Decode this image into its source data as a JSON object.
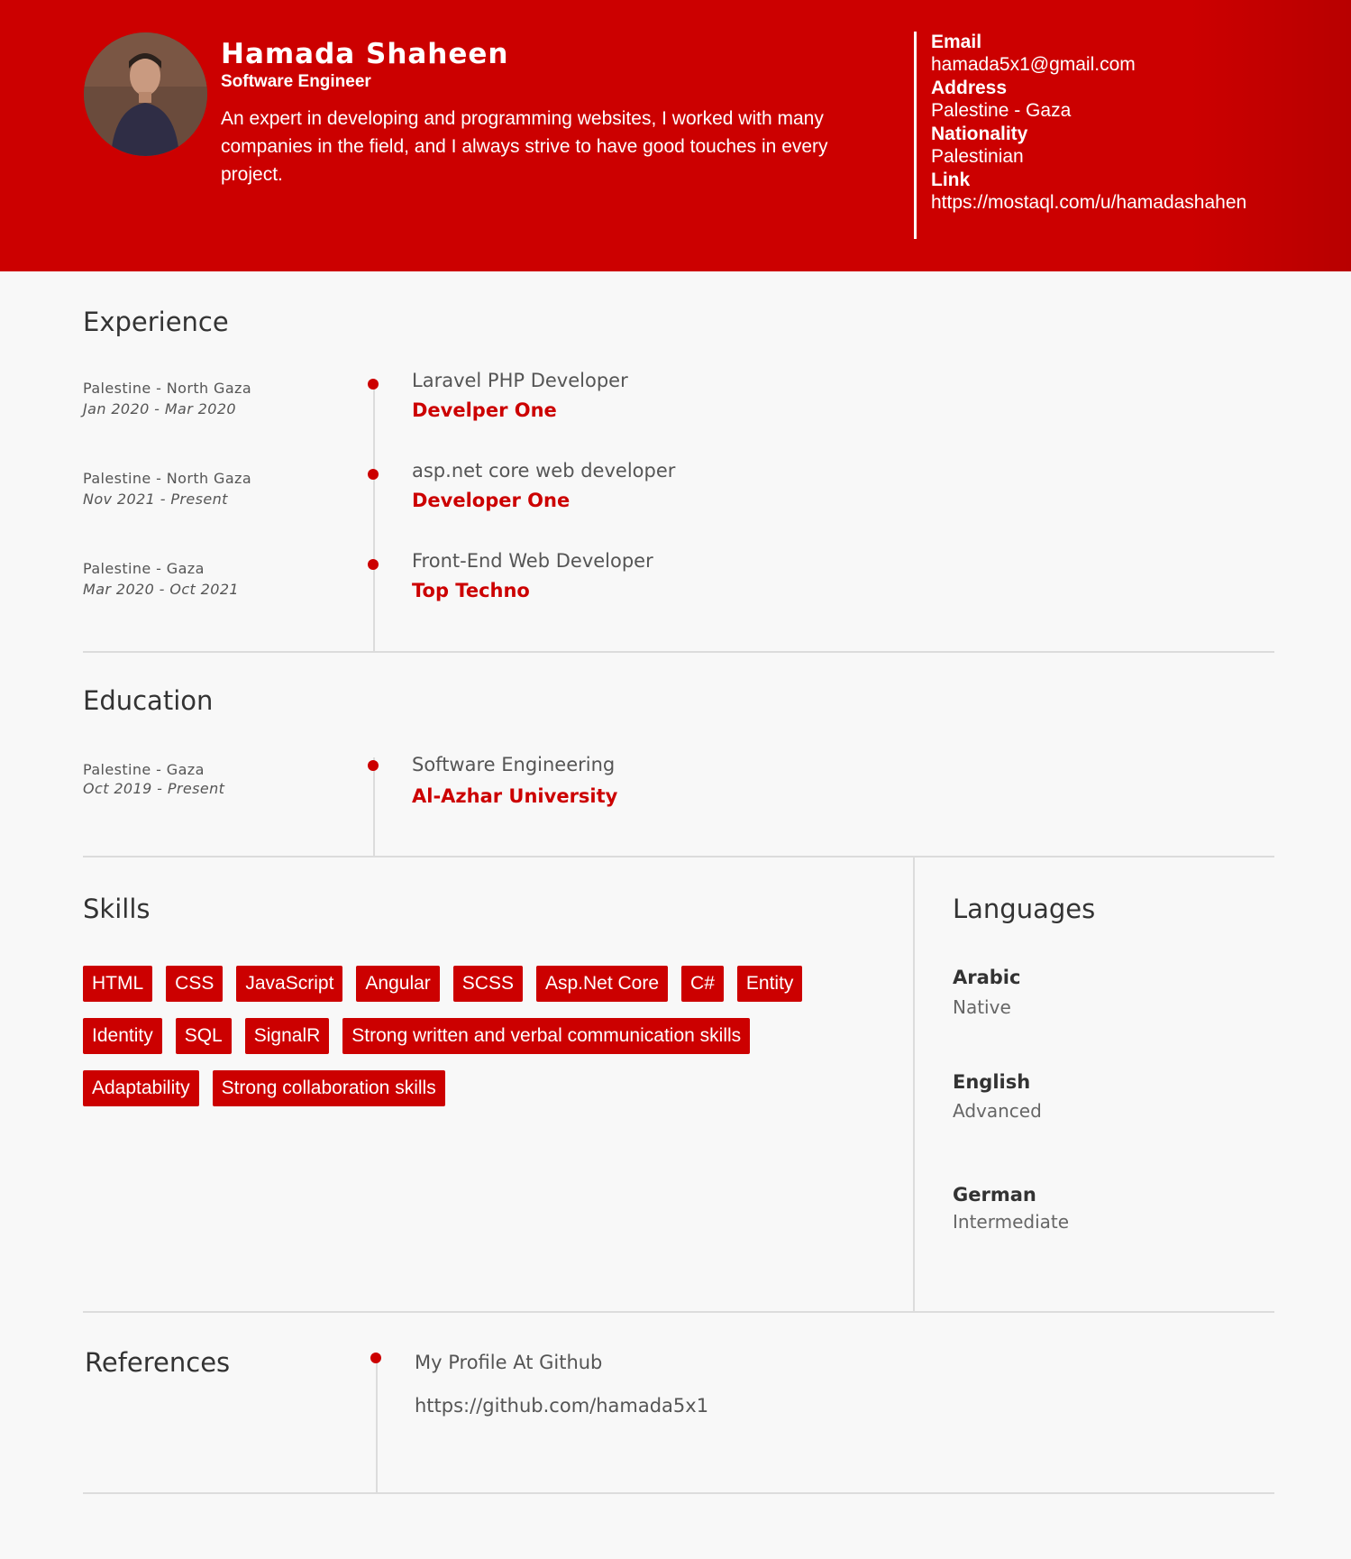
{
  "header": {
    "name": "Hamada Shaheen",
    "title": "Software Engineer",
    "bio": "An expert in developing and programming websites, I worked with many companies in the field, and I always strive to have good touches in every project.",
    "contact": [
      {
        "label": "Email",
        "value": "hamada5x1@gmail.com"
      },
      {
        "label": "Address",
        "value": "Palestine - Gaza"
      },
      {
        "label": "Nationality",
        "value": "Palestinian"
      },
      {
        "label": "Link",
        "value": "https://mostaql.com/u/hamadashahen"
      }
    ]
  },
  "experience": {
    "heading": "Experience",
    "items": [
      {
        "location": "Palestine - North Gaza",
        "dates": "Jan 2020 - Mar 2020",
        "role": "Laravel PHP Developer",
        "company": "Develper One"
      },
      {
        "location": "Palestine - North Gaza",
        "dates": "Nov 2021 - Present",
        "role": "asp.net core web developer",
        "company": "Developer One"
      },
      {
        "location": "Palestine - Gaza",
        "dates": "Mar 2020 - Oct 2021",
        "role": "Front-End Web Developer",
        "company": "Top Techno"
      }
    ]
  },
  "education": {
    "heading": "Education",
    "items": [
      {
        "location": "Palestine - Gaza",
        "dates": "Oct 2019 - Present",
        "degree": "Software Engineering",
        "school": "Al-Azhar University"
      }
    ]
  },
  "skills": {
    "heading": "Skills",
    "items": [
      "HTML",
      "CSS",
      "JavaScript",
      "Angular",
      "SCSS",
      "Asp.Net Core",
      "C#",
      "Entity",
      "Identity",
      "SQL",
      "SignalR",
      "Strong written and verbal communication skills",
      "Adaptability",
      "Strong collaboration skills"
    ]
  },
  "languages": {
    "heading": "Languages",
    "items": [
      {
        "name": "Arabic",
        "level": "Native"
      },
      {
        "name": "English",
        "level": "Advanced"
      },
      {
        "name": "German",
        "level": "Intermediate"
      }
    ]
  },
  "references": {
    "heading": "References",
    "item": {
      "title": "My Profile At Github",
      "url": "https://github.com/hamada5x1"
    }
  },
  "colors": {
    "accent": "#cc0000",
    "background": "#f8f8f8",
    "divider": "#dcdcdc"
  }
}
